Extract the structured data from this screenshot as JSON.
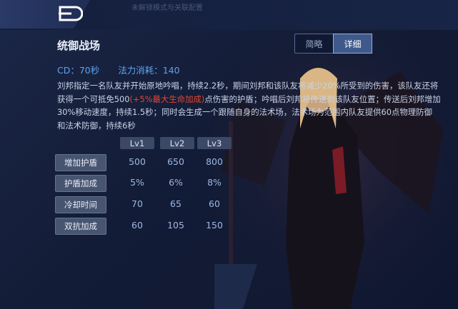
{
  "header": {
    "faint_text": "未解锁模式与关联配置"
  },
  "skill": {
    "title": "统御战场",
    "cd_label": "CD：70秒",
    "cost_label": "法力消耗：140",
    "desc_line1": "刘邦指定一名队友并开始原地吟唱，持续2.2秒，期间刘邦和该队友将减少20%所受到的伤害，该队友还将",
    "desc_line2_pre": "获得一个可抵免500",
    "desc_line2_hl": "(+5%最大生命加成)",
    "desc_line2_post": "点伤害的护盾；吟唱后刘邦将传送到该队友位置；传送后刘邦增加",
    "desc_line3": "30%移动速度，持续1.5秒；同时会生成一个跟随自身的法术场，法术场为范围内队友提供60点物理防御",
    "desc_line4": "和法术防御，持续6秒"
  },
  "toggle": {
    "simple": "简略",
    "detail": "详细"
  },
  "table": {
    "levels": [
      "Lv1",
      "Lv2",
      "Lv3"
    ],
    "rows": [
      {
        "label": "增加护盾",
        "values": [
          "500",
          "650",
          "800"
        ]
      },
      {
        "label": "护盾加成",
        "values": [
          "5%",
          "6%",
          "8%"
        ]
      },
      {
        "label": "冷却时间",
        "values": [
          "70",
          "65",
          "60"
        ]
      },
      {
        "label": "双抗加成",
        "values": [
          "60",
          "105",
          "150"
        ]
      }
    ]
  },
  "colors": {
    "accent_blue": "#5fa3ea",
    "highlight_red": "#e3462f",
    "panel_bg": "#1b2747"
  }
}
